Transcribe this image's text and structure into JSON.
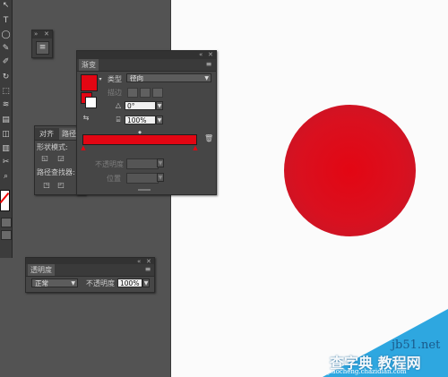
{
  "gradient_panel": {
    "tab": "渐变",
    "type_label": "类型",
    "type_value": "径向",
    "stroke_label": "描边",
    "angle_value": "0°",
    "ratio_value": "100%",
    "opacity_label": "不透明度",
    "position_label": "位置",
    "gradient_color": "#e30613"
  },
  "align_panel": {
    "tab_align": "对齐",
    "tab_pathfinder": "路径",
    "shape_modes_label": "形状模式:",
    "pathfinder_label": "路径查找器:"
  },
  "transparency_panel": {
    "tab": "透明度",
    "blend_mode": "正常",
    "opacity_label": "不透明度",
    "opacity_value": "100%"
  },
  "artwork": {
    "circle_fill_center": "#e30613",
    "circle_fill_edge": "#c0192b"
  },
  "watermark": {
    "site_line1": "jb51.net",
    "site_line2": "查字典 教程网",
    "site_line3": "jiaocheng.chazidian.com"
  }
}
